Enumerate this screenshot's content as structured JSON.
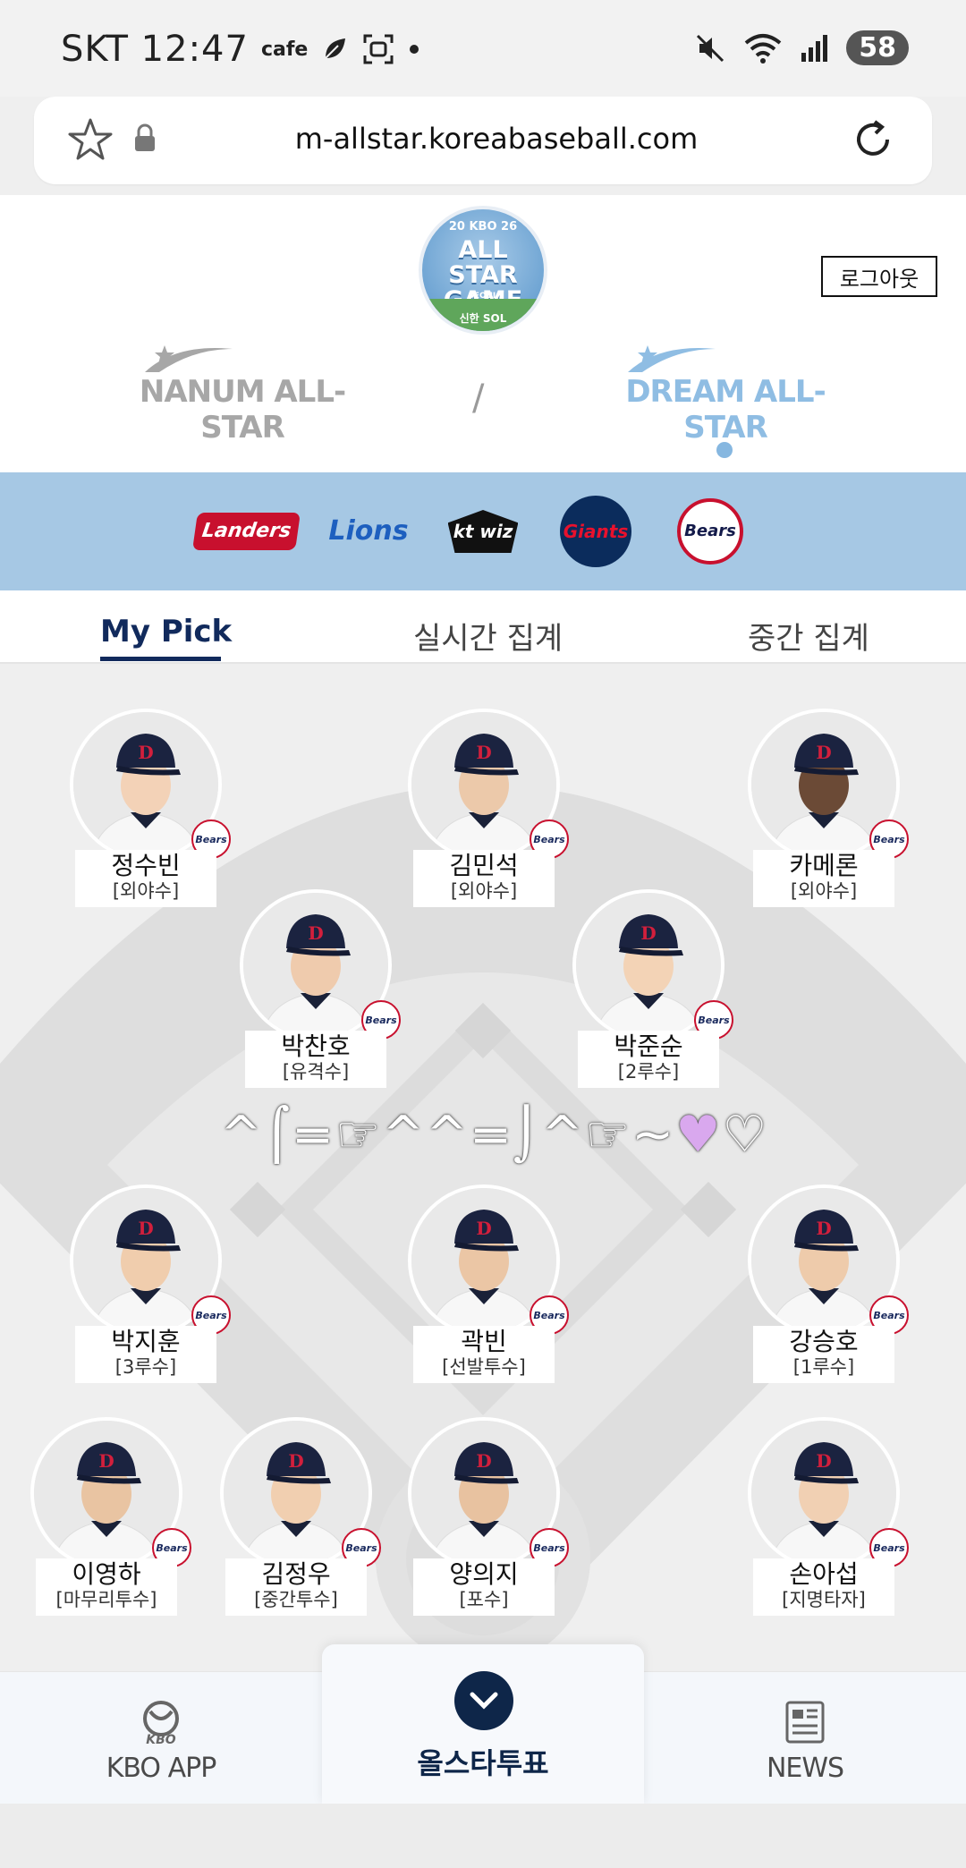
{
  "status_bar": {
    "carrier_time": "SKT 12:47",
    "app_label": "cafe",
    "battery": "58",
    "wifi_label": "6"
  },
  "browser": {
    "url": "m-allstar.koreabaseball.com"
  },
  "header": {
    "logo": {
      "top": "20 KBO 26",
      "main_line1": "ALL STAR",
      "main_line2": "GAME",
      "city": "SEOUL",
      "sponsor": "신한 SOL"
    },
    "logout_label": "로그아웃",
    "league_left": "NANUM ALL-STAR",
    "separator": "/",
    "league_right": "DREAM ALL-STAR"
  },
  "teams": [
    "Landers",
    "Lions",
    "kt wiz",
    "Giants",
    "Bears"
  ],
  "tabs": [
    {
      "label": "My Pick",
      "active": true
    },
    {
      "label": "실시간 집계",
      "active": false
    },
    {
      "label": "중간 집계",
      "active": false
    }
  ],
  "team_logo_text": "Bears",
  "players": [
    {
      "name": "정수빈",
      "position": "[외야수]"
    },
    {
      "name": "김민석",
      "position": "[외야수]"
    },
    {
      "name": "카메론",
      "position": "[외야수]"
    },
    {
      "name": "박찬호",
      "position": "[유격수]"
    },
    {
      "name": "박준순",
      "position": "[2루수]"
    },
    {
      "name": "박지훈",
      "position": "[3루수]"
    },
    {
      "name": "곽빈",
      "position": "[선발투수]"
    },
    {
      "name": "강승호",
      "position": "[1루수]"
    },
    {
      "name": "이영하",
      "position": "[마무리투수]"
    },
    {
      "name": "김정우",
      "position": "[중간투수]"
    },
    {
      "name": "양의지",
      "position": "[포수]"
    },
    {
      "name": "손아섭",
      "position": "[지명타자]"
    }
  ],
  "emoticon": {
    "text": "^⌠=☞^^=⌡^☞~",
    "heart_filled": "♥",
    "heart_outline": "♡"
  },
  "bottom_nav": {
    "left_brand": "KBO",
    "left_label": "KBO APP",
    "center_label": "올스타투표",
    "right_label": "NEWS"
  },
  "colors": {
    "navy": "#112a5c",
    "team_strip": "#a6c8e4",
    "dream_blue": "#8fbde3",
    "nanum_gray": "#a7a7a7"
  }
}
